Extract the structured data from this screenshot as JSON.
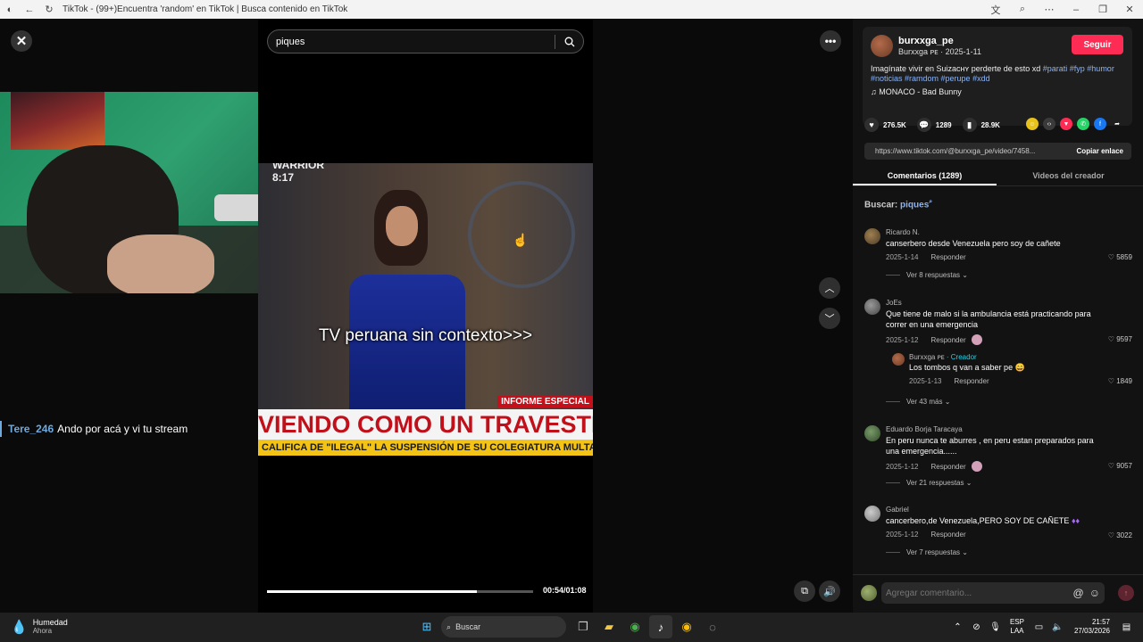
{
  "browser": {
    "title": "TikTok - (99+)Encuentra 'random' en TikTok | Busca contenido en TikTok"
  },
  "search": {
    "value": "piques"
  },
  "stream": {
    "chat_user": "Tere_246",
    "chat_message": "Ando por acá y vi tu stream"
  },
  "video": {
    "watermark_line1": "WARRIOR",
    "watermark_line2": "8:17",
    "caption": "TV peruana sin contexto>>>",
    "news_badge": "INFORME ESPECIAL",
    "headline": "VIENDO COMO UN TRAVESTI",
    "ticker": "CALIFICA DE \"ILEGAL\" LA SUSPENSIÓN DE SU COLEGIATURA   MULTAR",
    "time": "00:54/01:08",
    "progress": 0.79
  },
  "post": {
    "username": "burxxga_pe",
    "subline": "Burxxga ᴘᴇ · 2025-1-11",
    "follow_label": "Seguir",
    "description_text": "Imagínate vivir en Suizaᴄʜʏ perderte de esto xd",
    "hashtags_line1": "#parati #fyp #humor",
    "hashtags_line2": "#noticias #ramdom #perupe #xdd",
    "music": "MONACO - Bad Bunny",
    "likes": "276.5K",
    "comments_count": "1289",
    "saves": "28.9K",
    "link": "https://www.tiktok.com/@burxxga_pe/video/7458...",
    "copy_label": "Copiar enlace"
  },
  "tabs": {
    "comments": "Comentarios (1289)",
    "creator_videos": "Videos del creador"
  },
  "search_hint": {
    "label": "Buscar:",
    "query": "piques"
  },
  "comments": [
    {
      "name": "Ricardo N.",
      "text": "canserbero desde Venezuela pero soy de cañete",
      "date": "2025-1-14",
      "reply": "Responder",
      "likes": "5859",
      "more": "Ver 8 respuestas"
    },
    {
      "name": "JoEs",
      "text": "Que tiene de malo si la ambulancia está practicando para correr en una emergencia",
      "date": "2025-1-12",
      "reply": "Responder",
      "likes": "9597",
      "more": "Ver 43 más"
    },
    {
      "name": "Eduardo Borja Taracaya",
      "text": "En peru nunca te aburres , en peru estan preparados para una emergencia......",
      "date": "2025-1-12",
      "reply": "Responder",
      "likes": "9057",
      "more": "Ver 21 respuestas"
    },
    {
      "name": "Gabriel",
      "text": "cancerbero,de Venezuela,PERO SOY DE CAÑETE",
      "date": "2025-1-12",
      "reply": "Responder",
      "likes": "3022",
      "more": "Ver 7 respuestas"
    }
  ],
  "creator_reply": {
    "name": "Burxxga ᴘᴇ",
    "creator_tag": "· Creador",
    "text": "Los tombos q van a saber pe",
    "date": "2025-1-13",
    "reply": "Responder",
    "likes": "1849"
  },
  "add_comment": {
    "placeholder": "Agregar comentario..."
  },
  "taskbar": {
    "weather_label": "Humedad",
    "weather_sub": "Ahora",
    "search_label": "Buscar",
    "lang_line1": "ESP",
    "lang_line2": "LAA",
    "time": "21:57",
    "date": "27/03/2026"
  }
}
